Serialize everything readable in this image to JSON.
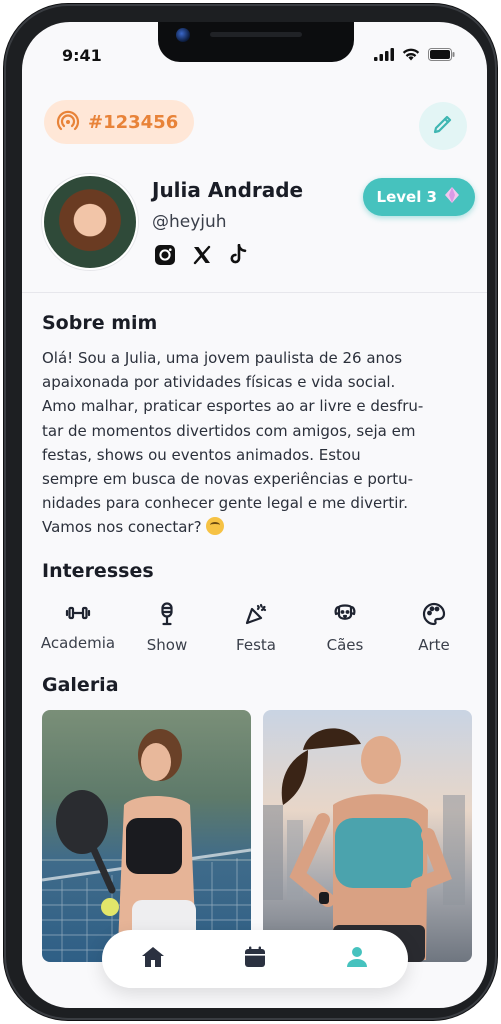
{
  "status_bar": {
    "time": "9:41",
    "icons": [
      "signal-icon",
      "wifi-icon",
      "battery-icon"
    ]
  },
  "profile": {
    "tag_icon": "broadcast-icon",
    "tag": "#123456",
    "edit_icon": "pencil-icon",
    "name": "Julia Andrade",
    "handle": "@heyjuh",
    "socials": [
      "instagram-icon",
      "x-icon",
      "tiktok-icon"
    ],
    "level_label": "Level 3",
    "level_icon": "diamond-icon"
  },
  "about": {
    "title": "Sobre mim",
    "lines": [
      "Olá! Sou a Julia, uma jovem paulista de 26 anos",
      "apaixonada por atividades físicas e vida social.",
      "Amo malhar, praticar esportes ao ar livre e desfru-",
      "tar de momentos divertidos com amigos, seja em",
      "festas, shows ou eventos animados. Estou",
      "sempre em busca de novas experiências e portu-",
      "nidades para conhecer gente legal e me divertir.",
      "Vamos nos conectar?"
    ],
    "emoji": "smiling-face-icon"
  },
  "interests": {
    "title": "Interesses",
    "items": [
      {
        "label": "Academia",
        "icon": "dumbbell-icon"
      },
      {
        "label": "Show",
        "icon": "microphone-icon"
      },
      {
        "label": "Festa",
        "icon": "party-popper-icon"
      },
      {
        "label": "Cães",
        "icon": "dog-icon"
      },
      {
        "label": "Arte",
        "icon": "palette-icon"
      }
    ]
  },
  "gallery": {
    "title": "Galeria",
    "photos": [
      "gallery-photo-padel",
      "gallery-photo-running"
    ]
  },
  "tabbar": {
    "items": [
      "home-icon",
      "calendar-icon",
      "user-icon"
    ],
    "active_index": 2
  },
  "colors": {
    "accent_teal": "#46c2be",
    "tag_orange": "#e88339",
    "tag_bg": "#ffe7d7"
  }
}
